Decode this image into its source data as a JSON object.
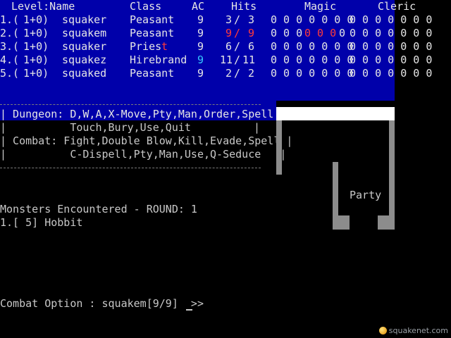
{
  "party_header": {
    "level_name": "Level:Name",
    "class": "Class",
    "ac": "AC",
    "hits": "Hits",
    "magic": "Magic",
    "cleric": "Cleric"
  },
  "party": [
    {
      "slot": "1.(",
      "level": " 1+0)",
      "name": "squaker",
      "class": "Peasant",
      "ac": "9",
      "hits_cur": "3",
      "hits_max": "3",
      "magic": "0 0 0 0 0 0 0",
      "cleric": "0 0 0 0 0 0 0"
    },
    {
      "slot": "2.(",
      "level": " 1+0)",
      "name": "squakem",
      "class": "Peasant",
      "ac": "9",
      "hits_cur": "9",
      "hits_max": "9",
      "magic": "0 0 0 0 0 0 0",
      "cleric": "0 0 0 0 0 0 0"
    },
    {
      "slot": "3.(",
      "level": " 1+0)",
      "name": "squaker",
      "class": "Priest",
      "ac": "9",
      "hits_cur": "6",
      "hits_max": "6",
      "magic": "0 0 0 0 0 0 0",
      "cleric": "0 0 0 0 0 0 0"
    },
    {
      "slot": "4.(",
      "level": " 1+0)",
      "name": "squakez",
      "class": "Hirebrand",
      "ac": "9",
      "hits_cur": "11",
      "hits_max": "11",
      "magic": "0 0 0 0 0 0 0",
      "cleric": "0 0 0 0 0 0 0"
    },
    {
      "slot": "5.(",
      "level": " 1+0)",
      "name": "squaked",
      "class": "Peasant",
      "ac": "9",
      "hits_cur": "2",
      "hits_max": "2",
      "magic": "0 0 0 0 0 0 0",
      "cleric": "0 0 0 0 0 0 0"
    }
  ],
  "menu": {
    "dungeon_line1": "| Dungeon: D,W,A,X-Move,Pty,Man,Order,Spell  |",
    "dungeon_line2": "|          Touch,Bury,Use,Quit",
    "combat_line1": "| Combat: Fight,Double Blow,Kill,Evade,Spell |",
    "combat_line2": "|          C-Dispell,Pty,Man,Use,Q-Seduce   |"
  },
  "map": {
    "party_label": "Party"
  },
  "encounter": {
    "title": "Monsters Encountered - ROUND: 1",
    "monsters": [
      "1.[ 5] Hobbit"
    ]
  },
  "prompt": {
    "text": "Combat Option : squakem[9/9]  >> "
  },
  "watermark": {
    "text": "squakenet.com"
  },
  "colors": {
    "panel_blue": "#0000aa",
    "highlight_red": "#ff3a3a",
    "highlight_cyan": "#35c8ff",
    "text_grey": "#c8c8c8"
  }
}
